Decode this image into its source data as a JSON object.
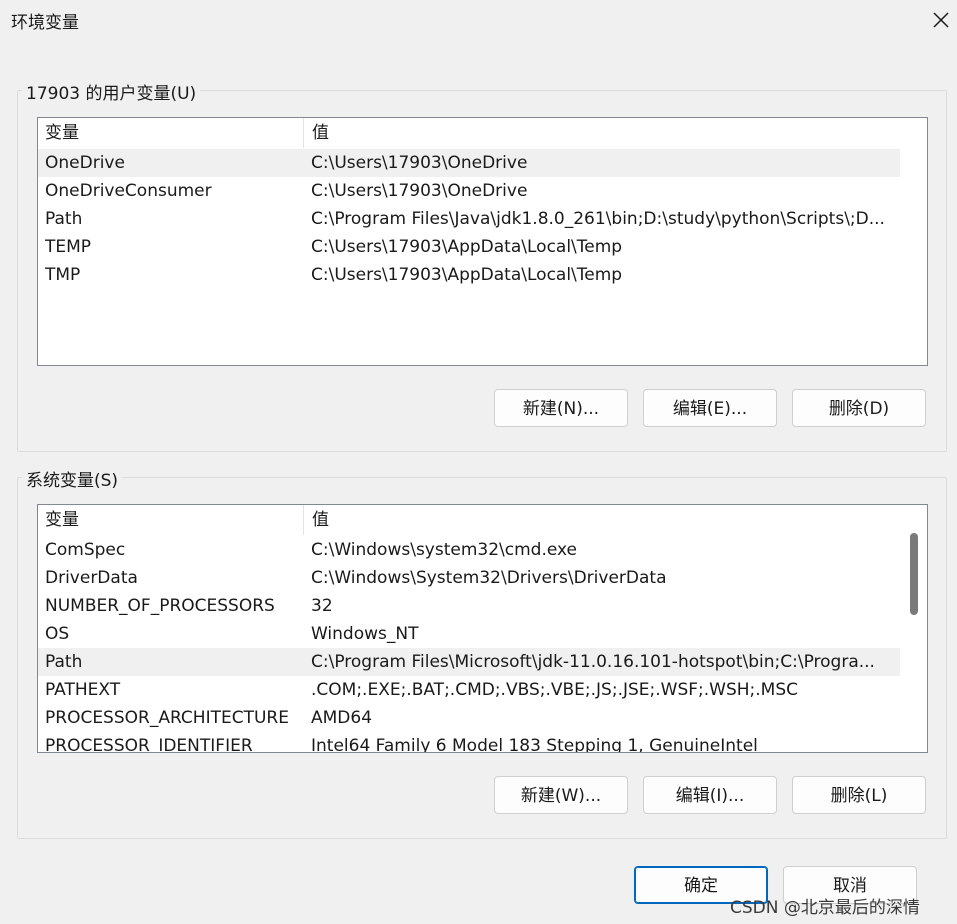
{
  "window": {
    "title": "环境变量",
    "close_icon": "close-icon"
  },
  "user_vars": {
    "label": "17903 的用户变量(U)",
    "columns": {
      "name": "变量",
      "value": "值"
    },
    "rows": [
      {
        "name": "OneDrive",
        "value": "C:\\Users\\17903\\OneDrive",
        "selected": true
      },
      {
        "name": "OneDriveConsumer",
        "value": "C:\\Users\\17903\\OneDrive",
        "selected": false
      },
      {
        "name": "Path",
        "value": "C:\\Program Files\\Java\\jdk1.8.0_261\\bin;D:\\study\\python\\Scripts\\;D...",
        "selected": false
      },
      {
        "name": "TEMP",
        "value": "C:\\Users\\17903\\AppData\\Local\\Temp",
        "selected": false
      },
      {
        "name": "TMP",
        "value": "C:\\Users\\17903\\AppData\\Local\\Temp",
        "selected": false
      }
    ],
    "buttons": {
      "new": "新建(N)...",
      "edit": "编辑(E)...",
      "delete": "删除(D)"
    }
  },
  "system_vars": {
    "label": "系统变量(S)",
    "columns": {
      "name": "变量",
      "value": "值"
    },
    "rows": [
      {
        "name": "ComSpec",
        "value": "C:\\Windows\\system32\\cmd.exe",
        "selected": false
      },
      {
        "name": "DriverData",
        "value": "C:\\Windows\\System32\\Drivers\\DriverData",
        "selected": false
      },
      {
        "name": "NUMBER_OF_PROCESSORS",
        "value": "32",
        "selected": false
      },
      {
        "name": "OS",
        "value": "Windows_NT",
        "selected": false
      },
      {
        "name": "Path",
        "value": "C:\\Program Files\\Microsoft\\jdk-11.0.16.101-hotspot\\bin;C:\\Progra...",
        "selected": true
      },
      {
        "name": "PATHEXT",
        "value": ".COM;.EXE;.BAT;.CMD;.VBS;.VBE;.JS;.JSE;.WSF;.WSH;.MSC",
        "selected": false
      },
      {
        "name": "PROCESSOR_ARCHITECTURE",
        "value": "AMD64",
        "selected": false
      },
      {
        "name": "PROCESSOR_IDENTIFIER",
        "value": "Intel64 Family 6 Model 183 Stepping 1, GenuineIntel",
        "selected": false
      }
    ],
    "buttons": {
      "new": "新建(W)...",
      "edit": "编辑(I)...",
      "delete": "删除(L)"
    }
  },
  "footer": {
    "ok": "确定",
    "cancel": "取消"
  },
  "watermark": "CSDN @北京最后的深情",
  "colors": {
    "accent": "#0067c0",
    "selected_row": "#f0f0f0",
    "scroll_thumb": "#7a7a7a"
  }
}
